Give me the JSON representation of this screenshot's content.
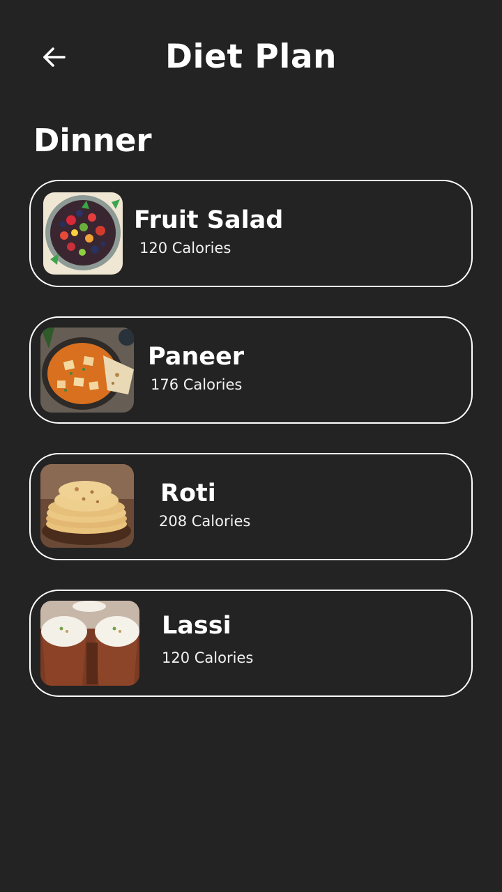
{
  "header": {
    "title": "Diet Plan",
    "back_icon": "arrow-left-icon"
  },
  "section": {
    "title": "Dinner"
  },
  "meals": [
    {
      "name": "Fruit Salad",
      "calories": "120 Calories",
      "image": "fruit-salad-image"
    },
    {
      "name": "Paneer",
      "calories": "176 Calories",
      "image": "paneer-curry-image"
    },
    {
      "name": "Roti",
      "calories": "208 Calories",
      "image": "roti-stack-image"
    },
    {
      "name": "Lassi",
      "calories": "120 Calories",
      "image": "lassi-glasses-image"
    }
  ],
  "colors": {
    "background": "#232323",
    "text": "#ffffff",
    "card_border": "#ffffff"
  }
}
